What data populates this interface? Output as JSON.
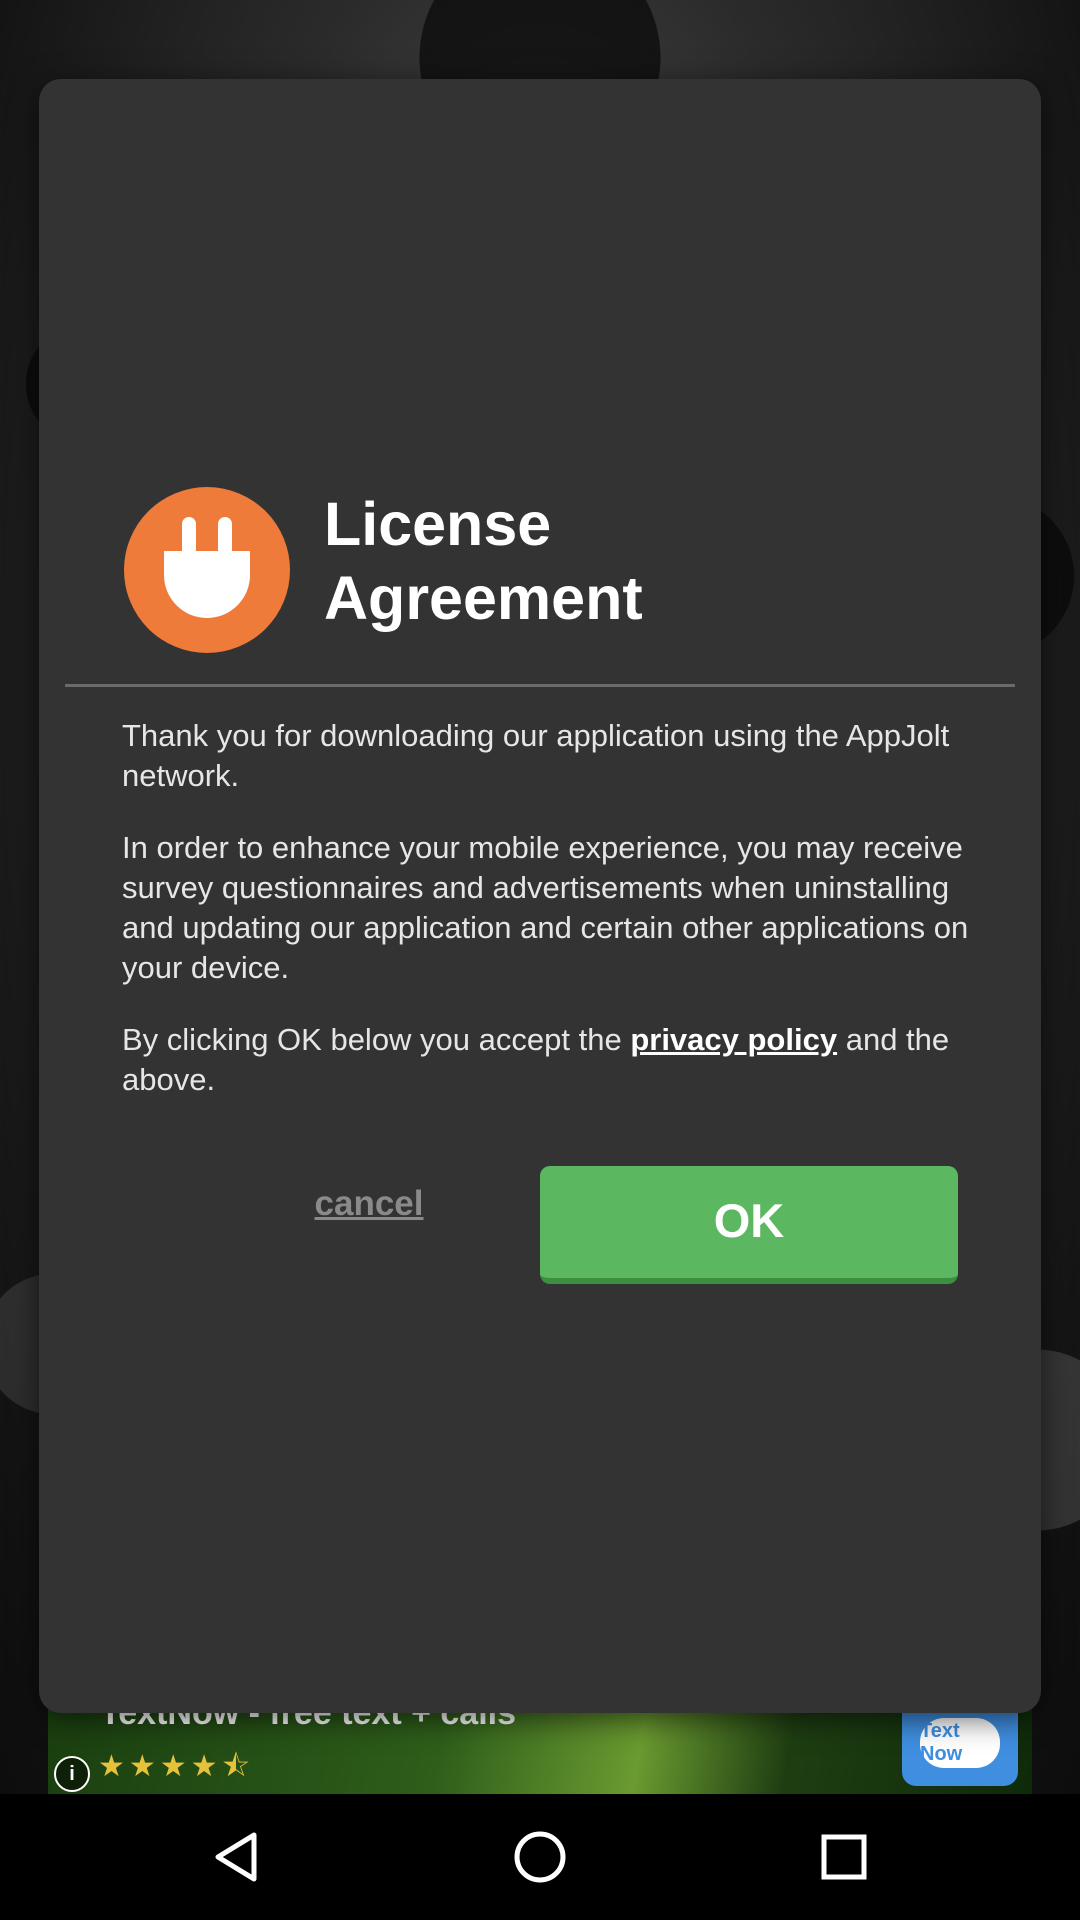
{
  "dialog": {
    "title": "License Agreement",
    "logo_icon": "plug-icon",
    "paragraph1": "Thank you for downloading our application using the AppJolt network.",
    "paragraph2": "In order to enhance your mobile experience, you may receive survey questionnaires and advertisements when uninstalling and updating our application and certain other applications on your device.",
    "paragraph3_before": "By clicking OK below you accept the ",
    "privacy_link": "privacy policy",
    "paragraph3_after": " and the above.",
    "cancel_label": "cancel",
    "ok_label": "OK"
  },
  "ad": {
    "title": "TextNow - free text + calls",
    "stars": "★★★★⯪",
    "rating": 4.5,
    "info_icon": "info-icon",
    "app_icon_text": "Text Now"
  },
  "navbar": {
    "back_icon": "back-triangle-icon",
    "home_icon": "home-circle-icon",
    "recents_icon": "recents-square-icon"
  },
  "colors": {
    "dialog_bg": "#333333",
    "accent_orange": "#ef7b3a",
    "ok_green": "#5cb860"
  }
}
